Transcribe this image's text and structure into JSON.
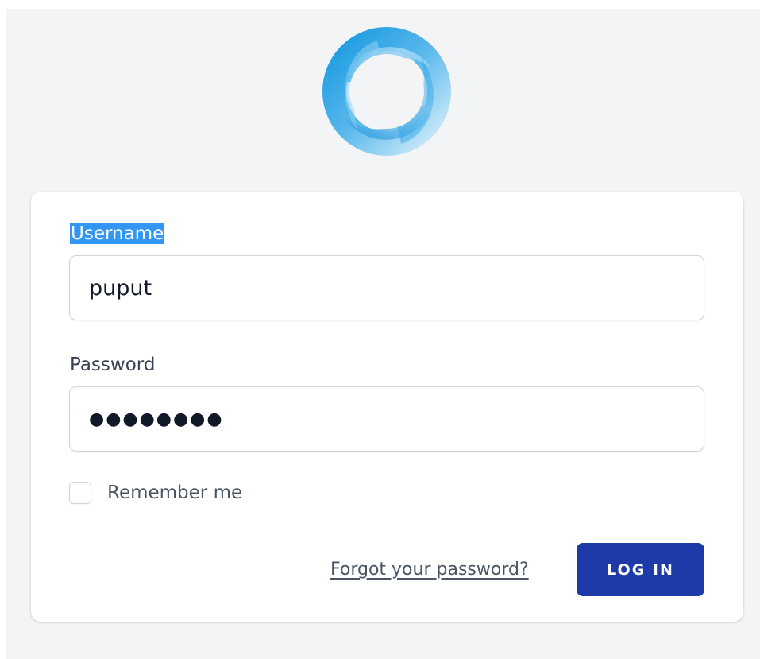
{
  "brand": {
    "logo_icon": "ring-swirl-logo-icon",
    "accent_light": "#bfe3f7",
    "accent_dark": "#1a9be0"
  },
  "form": {
    "username_label": "Username",
    "username_value": "puput",
    "password_label": "Password",
    "password_masked": "●●●●●●●●",
    "remember_label": "Remember me",
    "remember_checked": false,
    "forgot_label": "Forgot your password?",
    "login_label": "LOG IN"
  },
  "colors": {
    "page_bg": "#f3f4f6",
    "button_bg": "#1e3aa8",
    "selection_bg": "#3296f5"
  }
}
